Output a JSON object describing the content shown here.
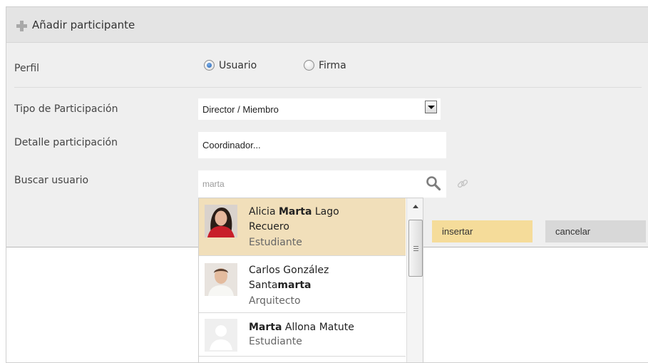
{
  "header": {
    "title": "Añadir participante"
  },
  "form": {
    "perfil_label": "Perfil",
    "perfil_options": [
      "Usuario",
      "Firma"
    ],
    "perfil_selected": "Usuario",
    "tipo_label": "Tipo de Participación",
    "tipo_value": "Director / Miembro",
    "detalle_label": "Detalle participación",
    "detalle_value": "Coordinador...",
    "buscar_label": "Buscar usuario",
    "buscar_value": "marta"
  },
  "buttons": {
    "insert": "insertar",
    "cancel": "cancelar"
  },
  "results": [
    {
      "name_pre": "Alicia ",
      "name_bold": "Marta",
      "name_post": " Lago",
      "name_line2_pre": "Recuero",
      "name_line2_bold": "",
      "role": "Estudiante",
      "selected": true
    },
    {
      "name_pre": "Carlos González",
      "name_bold": "",
      "name_post": "",
      "name_line2_pre": "Santa",
      "name_line2_bold": "marta",
      "role": "Arquitecto",
      "selected": false
    },
    {
      "name_pre": "",
      "name_bold": "Marta",
      "name_post": " Allona Matute",
      "name_line2_pre": "",
      "name_line2_bold": "",
      "role": "Estudiante",
      "selected": false
    }
  ],
  "colors": {
    "insert_button": "#f5dc9a",
    "cancel_button": "#d8d8d8",
    "selected_result": "#f1dfba",
    "header_bg": "#e4e4e4"
  },
  "icons": [
    "plus-icon",
    "search-icon",
    "link-icon"
  ]
}
